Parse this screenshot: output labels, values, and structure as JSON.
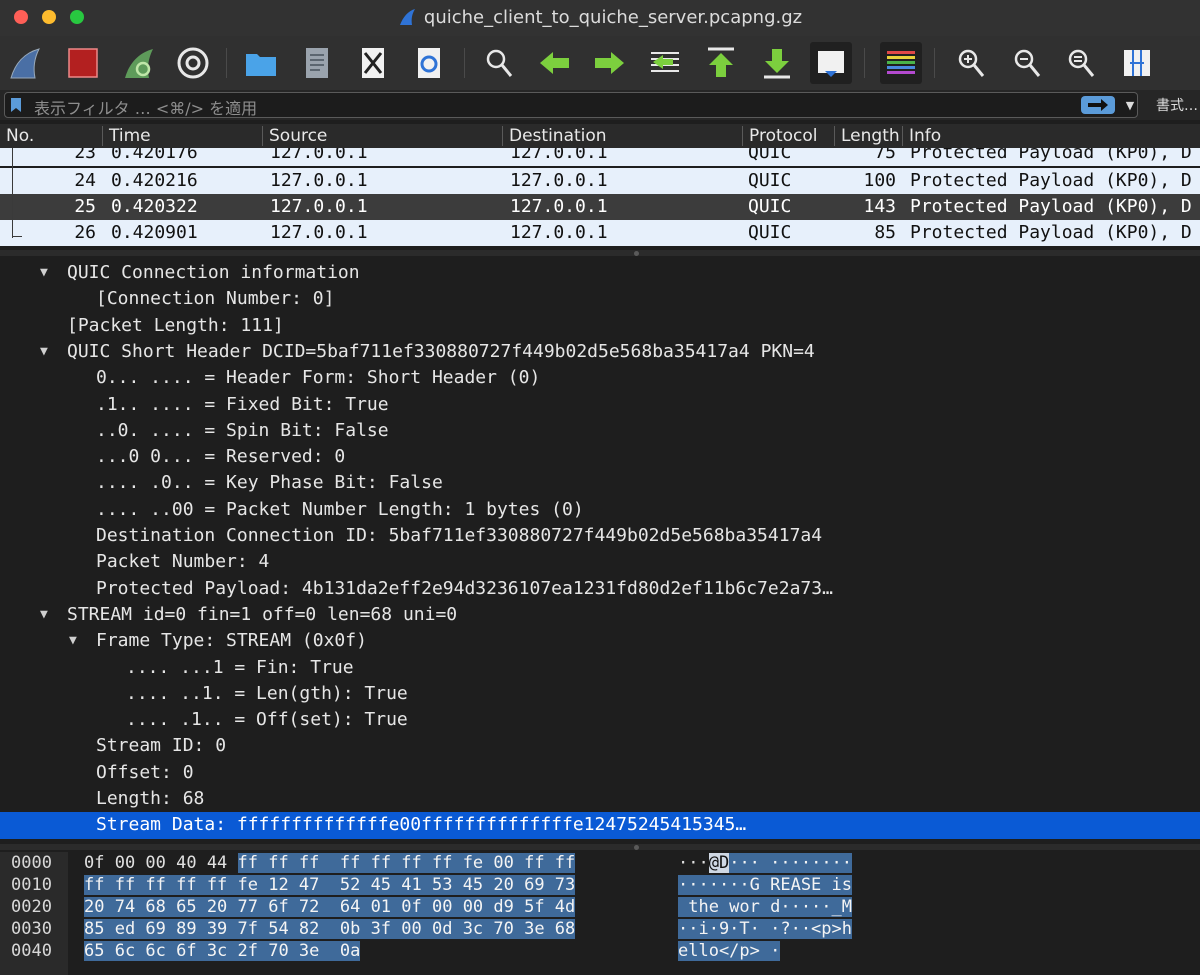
{
  "window": {
    "title": "quiche_client_to_quiche_server.pcapng.gz"
  },
  "toolbar": {
    "buttons": [
      {
        "name": "start-capture",
        "icon": "shark-fin-icon"
      },
      {
        "name": "stop-capture",
        "icon": "stop-square-icon"
      },
      {
        "name": "restart-capture",
        "icon": "shark-fin-restart-icon"
      },
      {
        "name": "capture-options",
        "icon": "gear-icon"
      },
      {
        "name": "open-file",
        "icon": "folder-icon"
      },
      {
        "name": "save-file",
        "icon": "file-binary-icon"
      },
      {
        "name": "close-file",
        "icon": "file-close-icon"
      },
      {
        "name": "reload-file",
        "icon": "file-reload-icon"
      },
      {
        "name": "find-packet",
        "icon": "magnifier-icon"
      },
      {
        "name": "go-back",
        "icon": "arrow-left-icon"
      },
      {
        "name": "go-forward",
        "icon": "arrow-right-icon"
      },
      {
        "name": "go-to-packet",
        "icon": "go-to-packet-icon"
      },
      {
        "name": "go-first",
        "icon": "arrow-up-bar-icon"
      },
      {
        "name": "go-last",
        "icon": "arrow-down-bar-icon"
      },
      {
        "name": "auto-scroll",
        "icon": "auto-scroll-icon"
      },
      {
        "name": "colorize",
        "icon": "colorize-lines-icon"
      },
      {
        "name": "zoom-in",
        "icon": "zoom-in-icon"
      },
      {
        "name": "zoom-out",
        "icon": "zoom-out-icon"
      },
      {
        "name": "normal-size",
        "icon": "zoom-reset-icon"
      },
      {
        "name": "resize-columns",
        "icon": "resize-columns-icon"
      }
    ]
  },
  "filter": {
    "placeholder": "表示フィルタ … <⌘/> を適用",
    "format_label": "書式…",
    "accent": "#5b9bd9"
  },
  "packet_list": {
    "columns": [
      "No.",
      "Time",
      "Source",
      "Destination",
      "Protocol",
      "Length",
      "Info"
    ],
    "rows": [
      {
        "no": "23",
        "time": "0.420176",
        "source": "127.0.0.1",
        "destination": "127.0.0.1",
        "protocol": "QUIC",
        "length": "75",
        "info": "Protected Payload (KP0), D"
      },
      {
        "no": "24",
        "time": "0.420216",
        "source": "127.0.0.1",
        "destination": "127.0.0.1",
        "protocol": "QUIC",
        "length": "100",
        "info": "Protected Payload (KP0), D"
      },
      {
        "no": "25",
        "time": "0.420322",
        "source": "127.0.0.1",
        "destination": "127.0.0.1",
        "protocol": "QUIC",
        "length": "143",
        "info": "Protected Payload (KP0), D",
        "selected": true
      },
      {
        "no": "26",
        "time": "0.420901",
        "source": "127.0.0.1",
        "destination": "127.0.0.1",
        "protocol": "QUIC",
        "length": "85",
        "info": "Protected Payload (KP0), D"
      }
    ]
  },
  "detail_tree": [
    {
      "level": 0,
      "expanded": true,
      "text": "QUIC Connection information"
    },
    {
      "level": 1,
      "text": "[Connection Number: 0]"
    },
    {
      "level": 0,
      "text": "[Packet Length: 111]"
    },
    {
      "level": 0,
      "expanded": true,
      "text": "QUIC Short Header DCID=5baf711ef330880727f449b02d5e568ba35417a4 PKN=4"
    },
    {
      "level": 1,
      "text": "0... .... = Header Form: Short Header (0)"
    },
    {
      "level": 1,
      "text": ".1.. .... = Fixed Bit: True"
    },
    {
      "level": 1,
      "text": "..0. .... = Spin Bit: False"
    },
    {
      "level": 1,
      "text": "...0 0... = Reserved: 0"
    },
    {
      "level": 1,
      "text": ".... .0.. = Key Phase Bit: False"
    },
    {
      "level": 1,
      "text": ".... ..00 = Packet Number Length: 1 bytes (0)"
    },
    {
      "level": 1,
      "text": "Destination Connection ID: 5baf711ef330880727f449b02d5e568ba35417a4"
    },
    {
      "level": 1,
      "text": "Packet Number: 4"
    },
    {
      "level": 1,
      "text": "Protected Payload: 4b131da2eff2e94d3236107ea1231fd80d2ef11b6c7e2a73…"
    },
    {
      "level": 0,
      "expanded": true,
      "text": "STREAM id=0 fin=1 off=0 len=68 uni=0"
    },
    {
      "level": 1,
      "expanded": true,
      "text": "Frame Type: STREAM (0x0f)"
    },
    {
      "level": 2,
      "text": ".... ...1 = Fin: True"
    },
    {
      "level": 2,
      "text": ".... ..1. = Len(gth): True"
    },
    {
      "level": 2,
      "text": ".... .1.. = Off(set): True"
    },
    {
      "level": 1,
      "text": "Stream ID: 0"
    },
    {
      "level": 1,
      "text": "Offset: 0"
    },
    {
      "level": 1,
      "text": "Length: 68"
    },
    {
      "level": 1,
      "text": "Stream Data: ffffffffffffffe00ffffffffffffffe12475245415345…",
      "selected": true
    }
  ],
  "hex_dump": {
    "offsets": [
      "0000",
      "0010",
      "0020",
      "0030",
      "0040"
    ],
    "rows": [
      {
        "plain": "0f 00 00 40 44 ",
        "hl": "ff ff ff  ff ff ff ff fe 00 ff ff",
        "a_plain": "···",
        "a_hl2": "@D",
        "a_hl": "··· ········"
      },
      {
        "plain": "",
        "hl": "ff ff ff ff ff fe 12 47  52 45 41 53 45 20 69 73",
        "a_plain": "",
        "a_hl2": "",
        "a_hl": "·······G REASE is"
      },
      {
        "plain": "",
        "hl": "20 74 68 65 20 77 6f 72  64 01 0f 00 00 d9 5f 4d",
        "a_plain": "",
        "a_hl2": "",
        "a_hl": " the wor d·····_M"
      },
      {
        "plain": "",
        "hl": "85 ed 69 89 39 7f 54 82  0b 3f 00 0d 3c 70 3e 68",
        "a_plain": "",
        "a_hl2": "",
        "a_hl": "··i·9·T· ·?··<p>h"
      },
      {
        "plain": "",
        "hl": "65 6c 6c 6f 3c 2f 70 3e  0a",
        "a_plain": "",
        "a_hl2": "",
        "a_hl": "ello</p> ·"
      }
    ]
  }
}
